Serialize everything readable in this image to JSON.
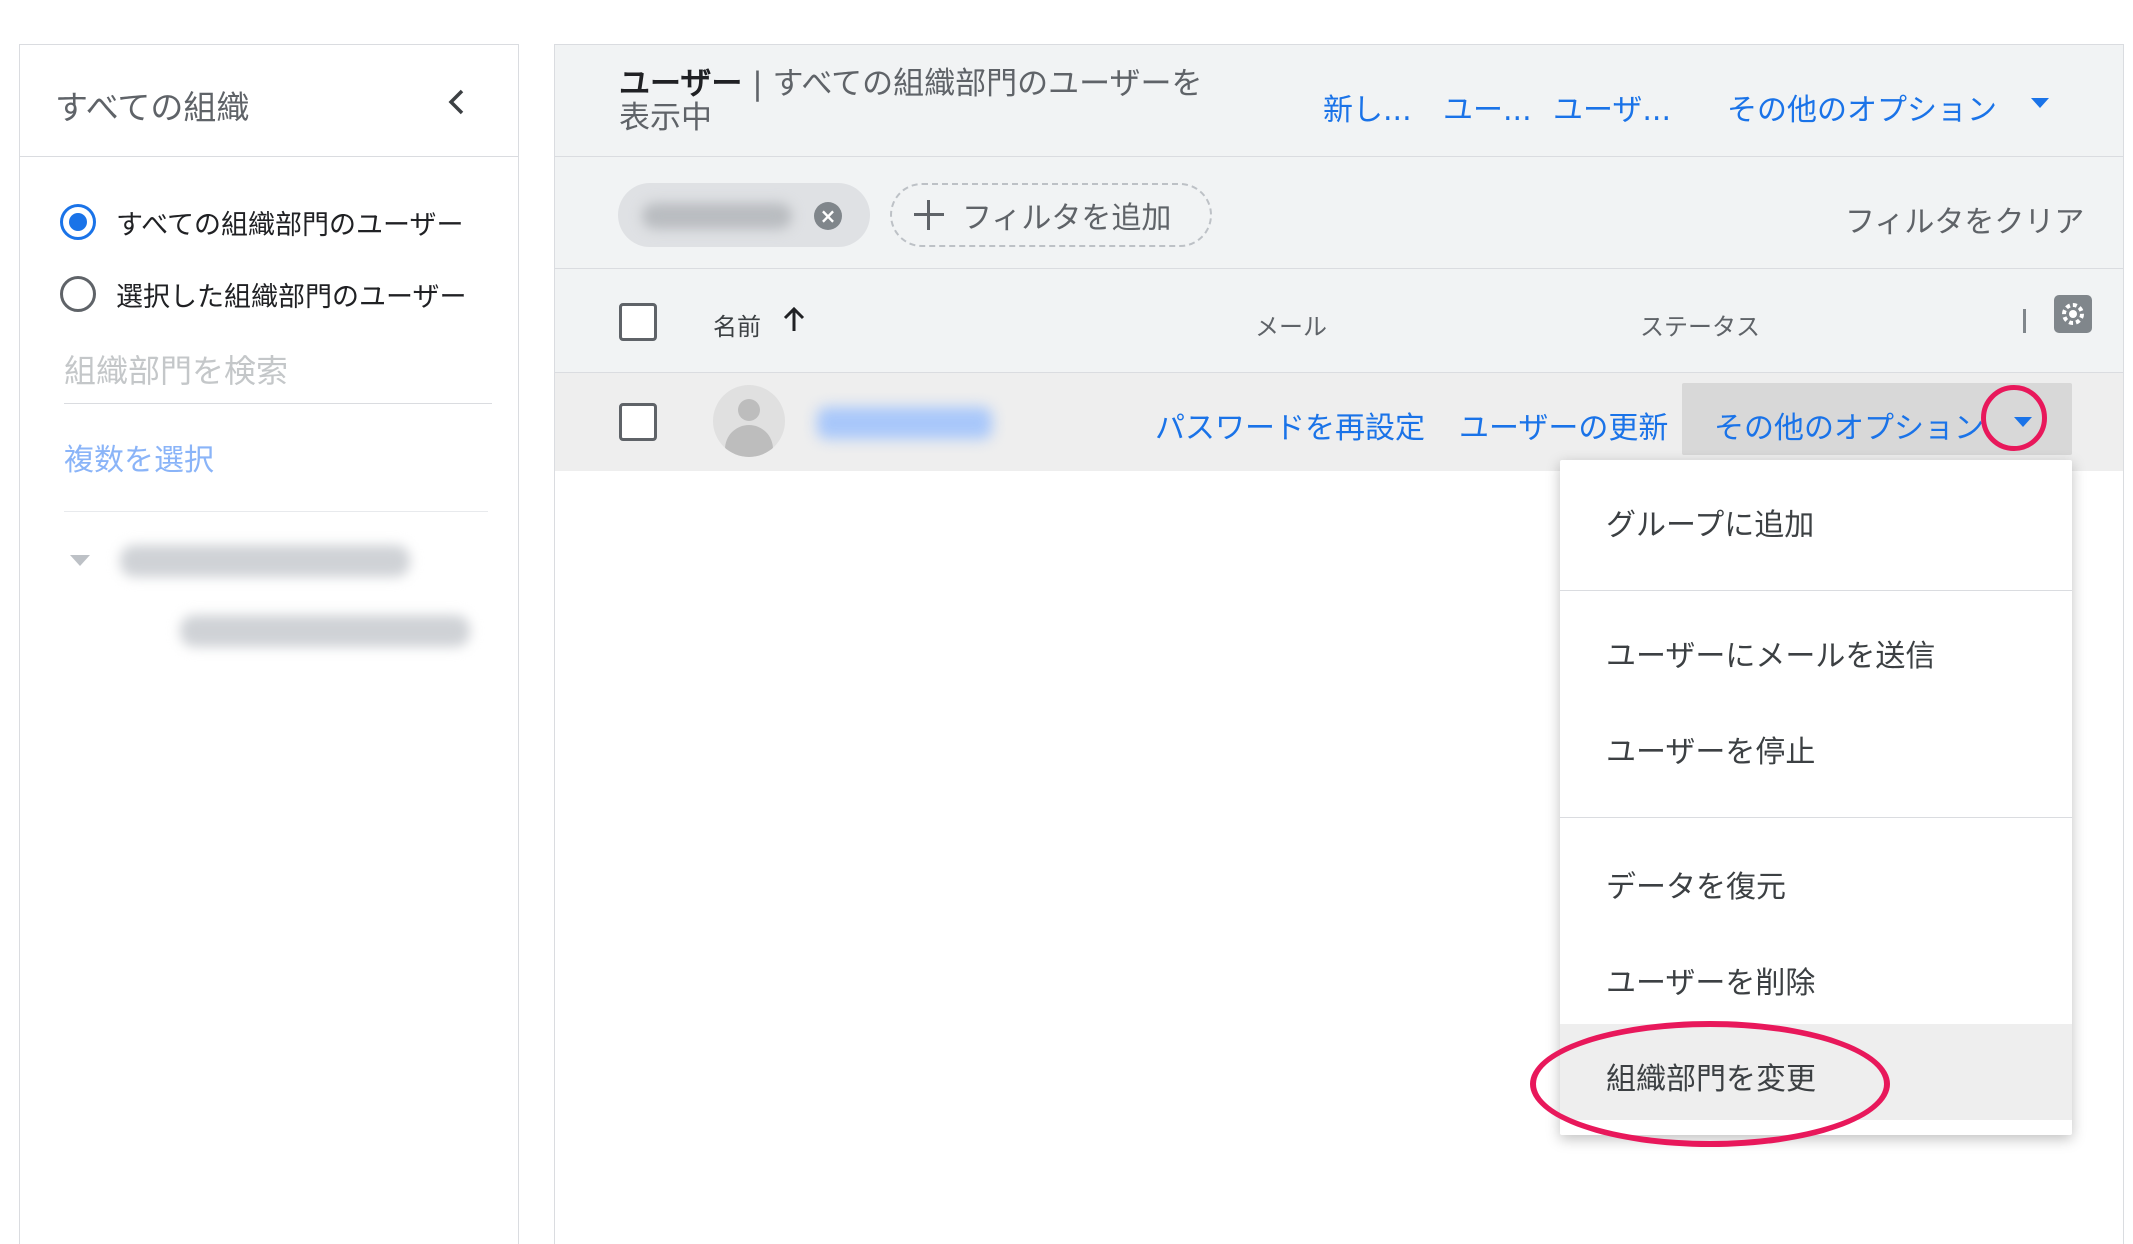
{
  "left_panel": {
    "title": "すべての組織",
    "scope_options": [
      {
        "label": "すべての組織部門のユーザー",
        "selected": true
      },
      {
        "label": "選択した組織部門のユーザー",
        "selected": false
      }
    ],
    "search": {
      "placeholder": "組織部門を検索",
      "value": ""
    },
    "multi_select_label": "複数を選択"
  },
  "header": {
    "title_strong": "ユーザー",
    "title_rest": " | すべての組織部門のユーザーを表示中",
    "links": [
      "新し...",
      "ユー...",
      "ユーザ..."
    ],
    "more_options": "その他のオプション"
  },
  "filters": {
    "add_filter": "フィルタを追加",
    "clear": "フィルタをクリア"
  },
  "table": {
    "columns": {
      "name": "名前",
      "email": "メール",
      "status": "ステータス"
    }
  },
  "user_row": {
    "reset_password": "パスワードを再設定",
    "update_user": "ユーザーの更新",
    "more_options": "その他のオプション"
  },
  "menu": {
    "items": [
      "グループに追加",
      "ユーザーにメールを送信",
      "ユーザーを停止",
      "データを復元",
      "ユーザーを削除",
      "組織部門を変更"
    ]
  },
  "colors": {
    "accent": "#1a73e8",
    "highlight": "#e8185b"
  }
}
